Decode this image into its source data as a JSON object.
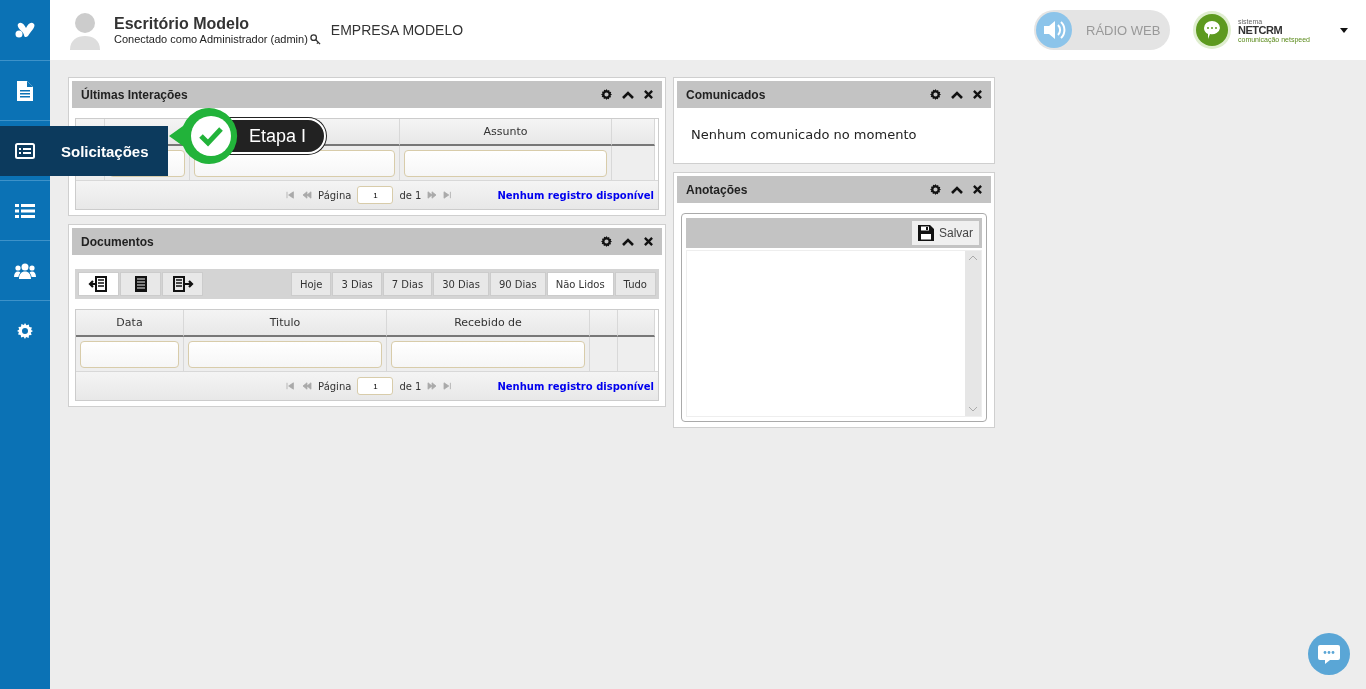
{
  "header": {
    "company": "Escritório Modelo",
    "user_line": "Conectado como Administrador (admin)",
    "empresa": "EMPRESA MODELO",
    "radio_label": "RÁDIO WEB",
    "radio_on": false,
    "brand_small": "sistema",
    "brand": "NETCRM",
    "brand_tagline": "comunicação netspeed"
  },
  "sidebar": {
    "items": [
      {
        "kind": "document",
        "selected": false
      },
      {
        "kind": "requests",
        "selected": true
      },
      {
        "kind": "list",
        "selected": false
      },
      {
        "kind": "users",
        "selected": false
      },
      {
        "kind": "settings",
        "selected": false
      }
    ],
    "flyout_label": "Solicitações"
  },
  "step_badge": {
    "label": "Etapa I",
    "done": true
  },
  "panels_left": [
    {
      "title": "Últimas Interações",
      "kind": "interactions",
      "columns": [
        {
          "filter": false
        },
        {
          "filter": true
        },
        {
          "filter": true
        },
        {
          "label": "Assunto",
          "filter": true
        },
        {
          "filter": false
        }
      ],
      "pager": {
        "page_label": "Página",
        "page": "1",
        "of": "de 1",
        "status": "Nenhum registro disponível"
      }
    },
    {
      "title": "Documentos",
      "kind": "documents",
      "toolbar": {
        "actions": [
          {
            "kind": "inbox",
            "selected": true
          },
          {
            "kind": "doc",
            "selected": false
          },
          {
            "kind": "outbox",
            "selected": false
          }
        ],
        "filters": [
          {
            "label": "Hoje",
            "selected": false
          },
          {
            "label": "3 Dias",
            "selected": false
          },
          {
            "label": "7 Dias",
            "selected": false
          },
          {
            "label": "30 Dias",
            "selected": false
          },
          {
            "label": "90 Dias",
            "selected": false
          },
          {
            "label": "Não Lidos",
            "selected": true
          },
          {
            "label": "Tudo",
            "selected": false
          }
        ]
      },
      "columns": [
        {
          "label": "Data",
          "filter": true
        },
        {
          "label": "Titulo",
          "filter": true
        },
        {
          "label": "Recebido de",
          "filter": true
        },
        {
          "filter": false
        },
        {
          "filter": false
        }
      ],
      "pager": {
        "page_label": "Página",
        "page": "1",
        "of": "de 1",
        "status": "Nenhum registro disponível"
      }
    }
  ],
  "comunicados": {
    "title": "Comunicados",
    "message": "Nenhum comunicado no momento"
  },
  "anotacoes": {
    "title": "Anotações",
    "save_label": "Salvar"
  }
}
